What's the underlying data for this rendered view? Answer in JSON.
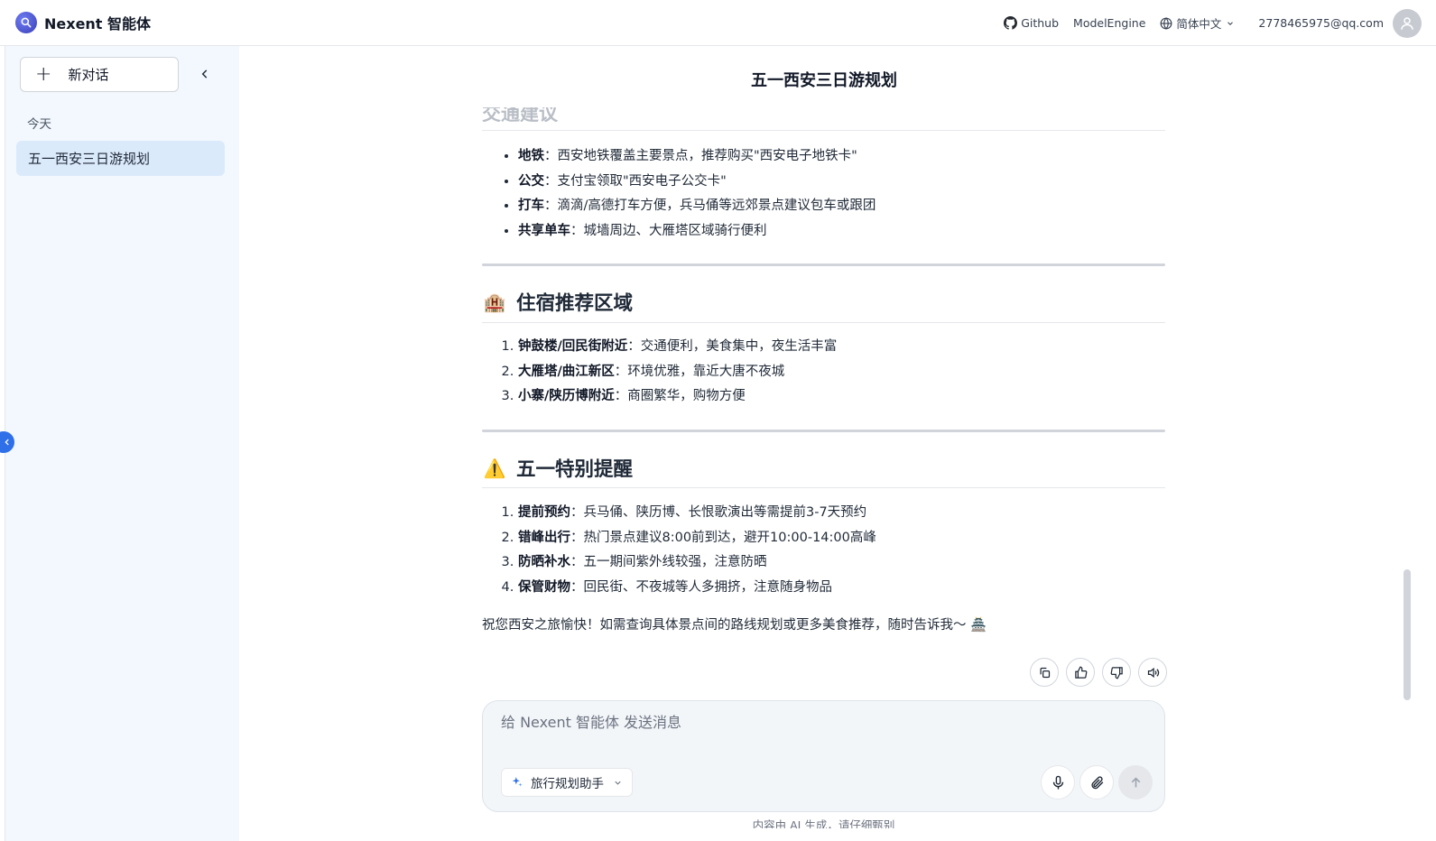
{
  "header": {
    "app_name": "Nexent 智能体",
    "github_label": "Github",
    "model_engine_label": "ModelEngine",
    "language_label": "简体中文",
    "user_email": "2778465975@qq.com"
  },
  "sidebar": {
    "new_chat_label": "新对话",
    "group_label": "今天",
    "conversations": [
      {
        "title": "五一西安三日游规划"
      }
    ]
  },
  "chat": {
    "title": "五一西安三日游规划",
    "clipped_heading": "交通建议",
    "transport": [
      {
        "term": "地铁",
        "desc": "：西安地铁覆盖主要景点，推荐购买\"西安电子地铁卡\""
      },
      {
        "term": "公交",
        "desc": "：支付宝领取\"西安电子公交卡\""
      },
      {
        "term": "打车",
        "desc": "：滴滴/高德打车方便，兵马俑等远郊景点建议包车或跟团"
      },
      {
        "term": "共享单车",
        "desc": "：城墙周边、大雁塔区域骑行便利"
      }
    ],
    "lodging": {
      "emoji": "🏨",
      "heading": "住宿推荐区域",
      "items": [
        {
          "term": "钟鼓楼/回民街附近",
          "desc": "：交通便利，美食集中，夜生活丰富"
        },
        {
          "term": "大雁塔/曲江新区",
          "desc": "：环境优雅，靠近大唐不夜城"
        },
        {
          "term": "小寨/陕历博附近",
          "desc": "：商圈繁华，购物方便"
        }
      ]
    },
    "reminders": {
      "emoji": "⚠️",
      "heading": "五一特别提醒",
      "items": [
        {
          "term": "提前预约",
          "desc": "：兵马俑、陕历博、长恨歌演出等需提前3-7天预约"
        },
        {
          "term": "错峰出行",
          "desc": "：热门景点建议8:00前到达，避开10:00-14:00高峰"
        },
        {
          "term": "防晒补水",
          "desc": "：五一期间紫外线较强，注意防晒"
        },
        {
          "term": "保管财物",
          "desc": "：回民街、不夜城等人多拥挤，注意随身物品"
        }
      ]
    },
    "closing": "祝您西安之旅愉快！如需查询具体景点间的路线规划或更多美食推荐，随时告诉我～ 🏯"
  },
  "composer": {
    "placeholder": "给 Nexent 智能体 发送消息",
    "agent_label": "旅行规划助手"
  },
  "footer": {
    "disclaimer": "内容由 AI 生成，请仔细甄别"
  },
  "colors": {
    "accent": "#2f6fe8",
    "sidebar_bg": "#f2f8fd",
    "active_item_bg": "#dbeafb"
  }
}
